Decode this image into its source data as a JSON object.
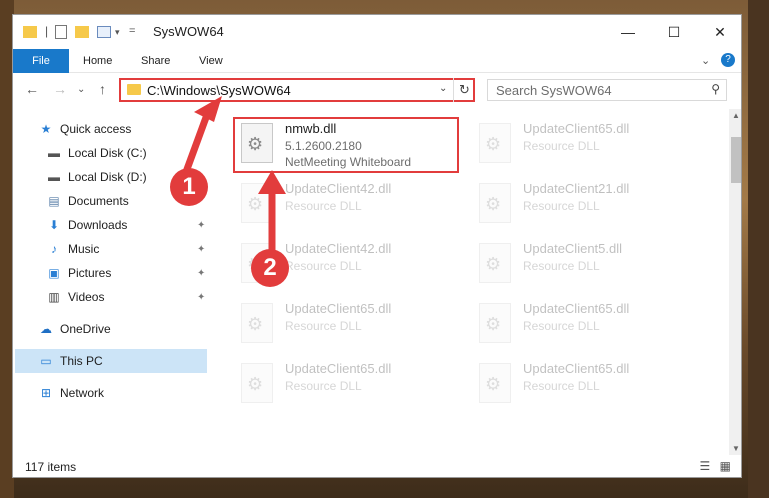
{
  "window": {
    "title": "SysWOW64",
    "controls": {
      "minimize": "—",
      "maximize": "☐",
      "close": "✕"
    }
  },
  "ribbon": {
    "tabs": [
      "File",
      "Home",
      "Share",
      "View"
    ],
    "collapse_glyph": "⌄",
    "help_glyph": "?"
  },
  "navigation": {
    "back": "←",
    "forward": "→",
    "recent": "⌄",
    "up": "↑"
  },
  "address_bar": {
    "path": "C:\\Windows\\SysWOW64",
    "dropdown_glyph": "⌄",
    "refresh_glyph": "↻"
  },
  "search": {
    "placeholder": "Search SysWOW64",
    "icon": "search-icon"
  },
  "sidebar": {
    "items": [
      {
        "label": "Quick access",
        "icon": "star-icon",
        "pinned": false
      },
      {
        "label": "Local Disk (C:)",
        "icon": "drive-icon",
        "pinned": false
      },
      {
        "label": "Local Disk (D:)",
        "icon": "drive-icon",
        "pinned": false
      },
      {
        "label": "Documents",
        "icon": "documents-icon",
        "pinned": false
      },
      {
        "label": "Downloads",
        "icon": "download-icon",
        "pinned": true
      },
      {
        "label": "Music",
        "icon": "music-icon",
        "pinned": true
      },
      {
        "label": "Pictures",
        "icon": "pictures-icon",
        "pinned": true
      },
      {
        "label": "Videos",
        "icon": "videos-icon",
        "pinned": true
      },
      {
        "label": "OneDrive",
        "icon": "cloud-icon",
        "pinned": false
      },
      {
        "label": "This PC",
        "icon": "computer-icon",
        "pinned": false,
        "selected": true
      },
      {
        "label": "Network",
        "icon": "network-icon",
        "pinned": false
      }
    ]
  },
  "files": [
    {
      "name": "nmwb.dll",
      "line2": "5.1.2600.2180",
      "line3": "NetMeeting Whiteboard",
      "highlighted": true
    },
    {
      "name": "UpdateClient65.dll",
      "line2": "Resource DLL",
      "line3": ""
    },
    {
      "name": "UpdateClient42.dll",
      "line2": "Resource DLL",
      "line3": ""
    },
    {
      "name": "UpdateClient21.dll",
      "line2": "Resource DLL",
      "line3": ""
    },
    {
      "name": "UpdateClient42.dll",
      "line2": "Resource DLL",
      "line3": ""
    },
    {
      "name": "UpdateClient5.dll",
      "line2": "Resource DLL",
      "line3": ""
    },
    {
      "name": "UpdateClient65.dll",
      "line2": "Resource DLL",
      "line3": ""
    },
    {
      "name": "UpdateClient65.dll",
      "line2": "Resource DLL",
      "line3": ""
    },
    {
      "name": "UpdateClient65.dll",
      "line2": "Resource DLL",
      "line3": ""
    },
    {
      "name": "UpdateClient65.dll",
      "line2": "Resource DLL",
      "line3": ""
    }
  ],
  "status": {
    "item_count": "117 items"
  },
  "annotations": {
    "step1": "1",
    "step2": "2",
    "accent_color": "#e23c3c"
  }
}
